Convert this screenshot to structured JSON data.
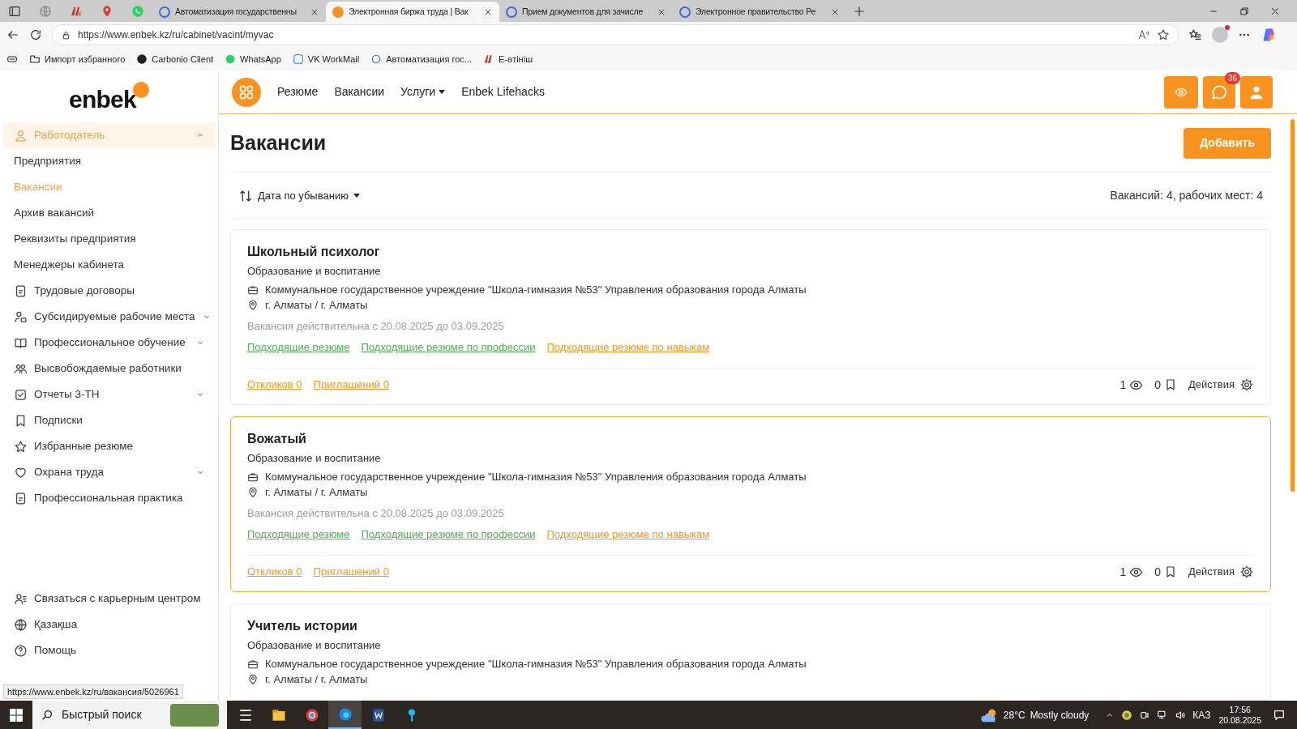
{
  "browser": {
    "tabs": [
      {
        "title": "Автоматизация государственны",
        "selected": false
      },
      {
        "title": "Электронная биржа труда | Вак",
        "selected": true
      },
      {
        "title": "Прием документов для зачисле",
        "selected": false
      },
      {
        "title": "Электронное правительство Ре",
        "selected": false
      }
    ],
    "address": "https://www.enbek.kz/ru/cabinet/vacint/myvac",
    "bookmarks": [
      "Импорт избранного",
      "Carbonio Client",
      "WhatsApp",
      "VK WorkMail",
      "Автоматизация гос...",
      "E-өтініш"
    ]
  },
  "sidebar": {
    "logo": "enbek",
    "items": [
      {
        "label": "Работодатель",
        "kind": "group",
        "expanded": true,
        "selected": true,
        "children": [
          {
            "label": "Предприятия",
            "selected": false
          },
          {
            "label": "Вакансии",
            "selected": true
          },
          {
            "label": "Архив вакансий",
            "selected": false
          },
          {
            "label": "Реквизиты предприятия",
            "selected": false
          },
          {
            "label": "Менеджеры кабинета",
            "selected": false
          }
        ]
      },
      {
        "label": "Трудовые договоры",
        "kind": "link",
        "selected": false
      },
      {
        "label": "Субсидируемые рабочие места",
        "kind": "group",
        "expanded": false,
        "selected": false
      },
      {
        "label": "Профессиональное обучение",
        "kind": "group",
        "expanded": false,
        "selected": false
      },
      {
        "label": "Высвобождаемые работники",
        "kind": "link",
        "selected": false
      },
      {
        "label": "Отчеты 3-ТН",
        "kind": "group",
        "expanded": false,
        "selected": false
      },
      {
        "label": "Подписки",
        "kind": "link",
        "selected": false
      },
      {
        "label": "Избранные резюме",
        "kind": "link",
        "selected": false
      },
      {
        "label": "Охрана труда",
        "kind": "group",
        "expanded": false,
        "selected": false
      },
      {
        "label": "Профессиональная практика",
        "kind": "link",
        "selected": false
      }
    ],
    "footer": [
      "Связаться с карьерным центром",
      "Қазақша",
      "Помощь"
    ]
  },
  "nav": {
    "items": [
      {
        "label": "Резюме",
        "kind": "link"
      },
      {
        "label": "Вакансии",
        "kind": "link"
      },
      {
        "label": "Услуги",
        "kind": "dropdown"
      },
      {
        "label": "Enbek Lifehacks",
        "kind": "link"
      }
    ],
    "messages_badge": "36"
  },
  "page": {
    "title": "Вакансии",
    "add_button": "Добавить",
    "sort": "Дата по убыванию",
    "summary": "Вакансий: 4, рабочих мест: 4",
    "vacancies": [
      {
        "title": "Школьный психолог",
        "category": "Образование и воспитание",
        "organization": "Коммунальное государственное учреждение \"Школа-гимназия №53\" Управления образования города Алматы",
        "location": "г. Алматы / г. Алматы",
        "validity": "Вакансия действительна с 20.08.2025 до 03.09.2025",
        "highlighted": false,
        "links": [
          {
            "label": "Подходящие резюме",
            "color": "#4caf50"
          },
          {
            "label": "Подходящие резюме по профессии",
            "color": "#4caf50"
          },
          {
            "label": "Подходящие резюме по навыкам",
            "color": "#f7931e"
          }
        ],
        "responses": "Откликов 0",
        "invitations": "Приглашений 0",
        "views": "1",
        "saved": "0",
        "actions": "Действия"
      },
      {
        "title": "Вожатый",
        "category": "Образование и воспитание",
        "organization": "Коммунальное государственное учреждение \"Школа-гимназия №53\" Управления образования города Алматы",
        "location": "г. Алматы / г. Алматы",
        "validity": "Вакансия действительна с 20.08.2025 до 03.09.2025",
        "highlighted": true,
        "links": [
          {
            "label": "Подходящие резюме",
            "color": "#4caf50"
          },
          {
            "label": "Подходящие резюме по профессии",
            "color": "#4caf50"
          },
          {
            "label": "Подходящие резюме по навыкам",
            "color": "#f7931e"
          }
        ],
        "responses": "Откликов 0",
        "invitations": "Приглашений 0",
        "views": "1",
        "saved": "0",
        "actions": "Действия"
      },
      {
        "title": "Учитель истории",
        "category": "Образование и воспитание",
        "organization": "Коммунальное государственное учреждение \"Школа-гимназия №53\" Управления образования города Алматы",
        "location": "г. Алматы / г. Алматы",
        "highlighted": false
      }
    ]
  },
  "status_url": "https://www.enbek.kz/ru/вакансия/5026961",
  "taskbar": {
    "search": "Быстрый поиск",
    "apps": [
      {
        "selected": false
      },
      {
        "selected": false
      },
      {
        "selected": false
      },
      {
        "selected": true
      },
      {
        "selected": false
      },
      {
        "selected": false
      }
    ],
    "temperature": "28°C",
    "weather": "Mostly cloudy",
    "language": "КАЗ",
    "time": "17:56",
    "date": "20.08.2025"
  }
}
